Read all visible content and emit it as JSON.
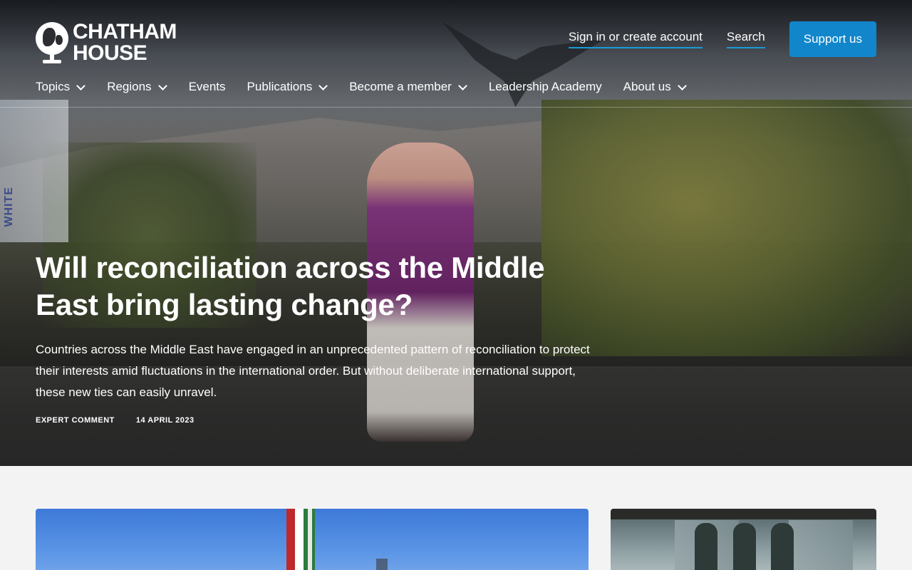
{
  "header": {
    "logo_line1": "CHATHAM",
    "logo_line2": "HOUSE",
    "sign_in_label": "Sign in or create account",
    "search_label": "Search",
    "support_label": "Support us"
  },
  "nav": {
    "items": [
      {
        "label": "Topics",
        "has_dropdown": true
      },
      {
        "label": "Regions",
        "has_dropdown": true
      },
      {
        "label": "Events",
        "has_dropdown": false
      },
      {
        "label": "Publications",
        "has_dropdown": true
      },
      {
        "label": "Become a member",
        "has_dropdown": true
      },
      {
        "label": "Leadership Academy",
        "has_dropdown": false
      },
      {
        "label": "About us",
        "has_dropdown": true
      }
    ]
  },
  "hero": {
    "photo_sign_text": "WHITE",
    "title": "Will reconciliation across the Middle East bring lasting change?",
    "summary": "Countries across the Middle East have engaged in an unprecedented pattern of reconciliation to protect their interests amid fluctuations in the international order. But without deliberate international support, these new ties can easily unravel.",
    "type": "EXPERT COMMENT",
    "date": "14 APRIL 2023"
  },
  "colors": {
    "accent": "#1186cb",
    "link_underline": "#1a9ad6",
    "page_background": "#f3f3f3"
  }
}
